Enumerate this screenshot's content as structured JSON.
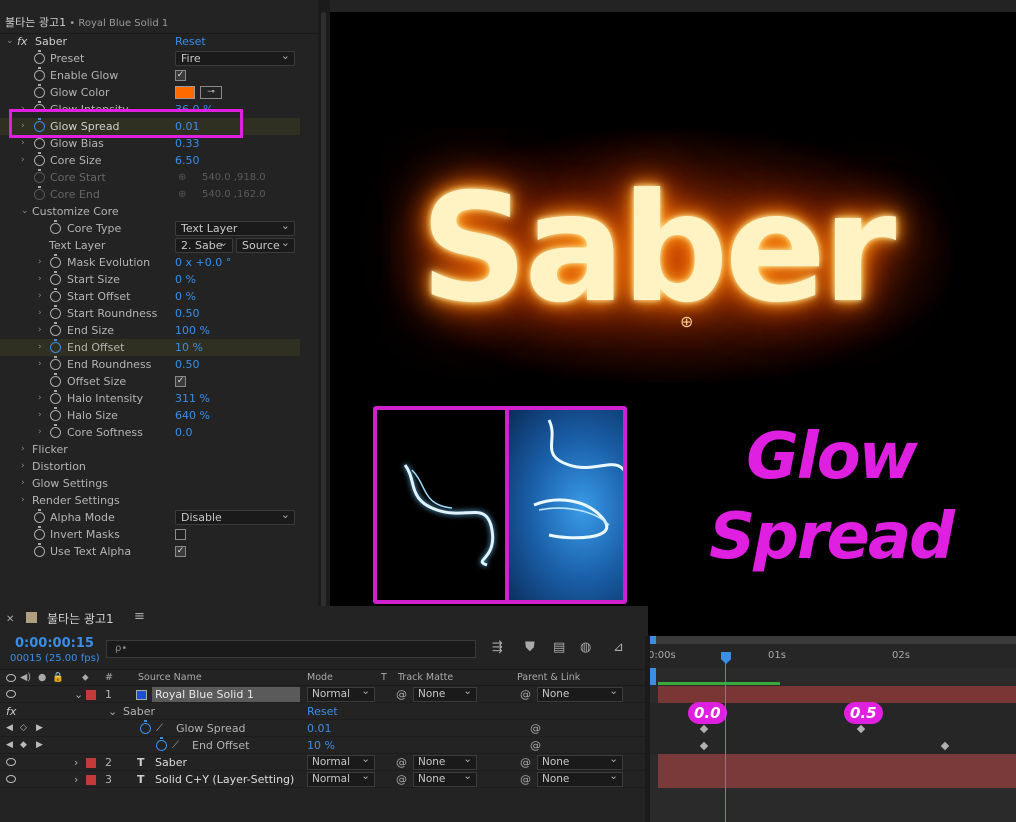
{
  "effects_panel": {
    "header_title": "불타는 광고1",
    "header_sub": " • Royal Blue Solid 1",
    "effect_name": "Saber",
    "reset_label": "Reset",
    "rows": {
      "preset": {
        "label": "Preset",
        "value": "Fire"
      },
      "enable_glow": {
        "label": "Enable Glow"
      },
      "glow_color": {
        "label": "Glow Color"
      },
      "glow_intensity": {
        "label": "Glow Intensity",
        "value": "36.0 %"
      },
      "glow_spread": {
        "label": "Glow Spread",
        "value": "0.01"
      },
      "glow_bias": {
        "label": "Glow Bias",
        "value": "0.33"
      },
      "core_size": {
        "label": "Core Size",
        "value": "6.50"
      },
      "core_start": {
        "label": "Core Start",
        "value": "540.0 ,918.0"
      },
      "core_end": {
        "label": "Core End",
        "value": "540.0 ,162.0"
      },
      "customize_core": {
        "label": "Customize Core"
      },
      "core_type": {
        "label": "Core Type",
        "value": "Text Layer"
      },
      "text_layer": {
        "label": "Text Layer",
        "value": "2. Sabe",
        "value2": "Source"
      },
      "mask_evolution": {
        "label": "Mask Evolution",
        "value": "0 x +0.0 °"
      },
      "start_size": {
        "label": "Start Size",
        "value": "0 %"
      },
      "start_offset": {
        "label": "Start Offset",
        "value": "0 %"
      },
      "start_roundness": {
        "label": "Start Roundness",
        "value": "0.50"
      },
      "end_size": {
        "label": "End Size",
        "value": "100 %"
      },
      "end_offset": {
        "label": "End Offset",
        "value": "10 %"
      },
      "end_roundness": {
        "label": "End Roundness",
        "value": "0.50"
      },
      "offset_size": {
        "label": "Offset Size"
      },
      "halo_intensity": {
        "label": "Halo Intensity",
        "value": "311 %"
      },
      "halo_size": {
        "label": "Halo Size",
        "value": "640 %"
      },
      "core_softness": {
        "label": "Core Softness",
        "value": "0.0"
      },
      "flicker": {
        "label": "Flicker"
      },
      "distortion": {
        "label": "Distortion"
      },
      "glow_settings": {
        "label": "Glow Settings"
      },
      "render_settings": {
        "label": "Render Settings"
      },
      "alpha_mode": {
        "label": "Alpha Mode",
        "value": "Disable"
      },
      "invert_masks": {
        "label": "Invert Masks"
      },
      "use_text_alpha": {
        "label": "Use Text Alpha"
      }
    },
    "glow_color_hex": "#ff6a00"
  },
  "viewer": {
    "fire_text": "Saber",
    "overlay_line1": "Glow",
    "overlay_line2": "Spread",
    "accent_color": "#e020e0"
  },
  "timeline": {
    "tab_title": "불타는 광고1",
    "timecode": "0:00:00:15",
    "fps": "00015 (25.00 fps)",
    "search_placeholder": "ρ•",
    "columns": {
      "num": "#",
      "source": "Source Name",
      "mode": "Mode",
      "t": "T",
      "matte": "Track Matte",
      "parent": "Parent & Link"
    },
    "layers": [
      {
        "num": "1",
        "name": "Royal Blue Solid 1",
        "mode": "Normal",
        "matte": "None",
        "parent": "None"
      },
      {
        "num": "2",
        "name": "Saber",
        "mode": "Normal",
        "matte": "None",
        "parent": "None"
      },
      {
        "num": "3",
        "name": "Solid  C+Y (Layer-Setting)",
        "mode": "Normal",
        "matte": "None",
        "parent": "None"
      }
    ],
    "fx_row": {
      "label": "fx",
      "effect": "Saber",
      "reset": "Reset"
    },
    "props": [
      {
        "name": "Glow Spread",
        "value": "0.01"
      },
      {
        "name": "End Offset",
        "value": "10 %"
      }
    ],
    "ruler_ticks": [
      "0:00s",
      "01s",
      "02s"
    ],
    "keyframe_labels": [
      "0.0",
      "0.5"
    ]
  }
}
